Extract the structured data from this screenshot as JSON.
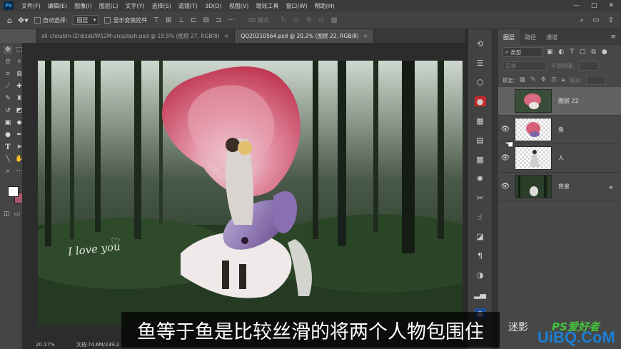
{
  "app": {
    "logo": "Ps",
    "menus": [
      "文件(F)",
      "编辑(E)",
      "图像(I)",
      "图层(L)",
      "文字(Y)",
      "选择(S)",
      "滤镜(T)",
      "3D(D)",
      "视图(V)",
      "增效工具",
      "窗口(W)",
      "帮助(H)"
    ],
    "window_controls": [
      "—",
      "□",
      "✕"
    ]
  },
  "options": {
    "auto_select_label": "自动选择:",
    "auto_select_value": "图层",
    "show_transform_label": "显示变换控件",
    "mode_label": "3D 模式:"
  },
  "tabs": [
    {
      "title": "ali-choubin-lZnbzaUWS2M-unsplash.psd @ 19.5% (图层 27, RGB/8)",
      "active": false
    },
    {
      "title": "QQ20210564.psd @ 20.2% (图层 22, RGB/8)",
      "active": true
    }
  ],
  "tab_close": "×",
  "canvas": {
    "overlay_text": "I love you"
  },
  "status": {
    "zoom": "20.17%",
    "doc_size": "文档:74.6M/239.2"
  },
  "layers_panel": {
    "tabs": [
      "图层",
      "路径",
      "通道"
    ],
    "filter_label": "类型",
    "blend_mode": "正常",
    "opacity_label": "不透明度:",
    "lock_label": "锁定:",
    "fill_label": "填充:",
    "layers": [
      {
        "name": "图层 22",
        "visible": false,
        "selected": true,
        "locked": false
      },
      {
        "name": "鱼",
        "visible": true,
        "selected": false,
        "locked": false
      },
      {
        "name": "人",
        "visible": true,
        "selected": false,
        "locked": false
      },
      {
        "name": "背景",
        "visible": true,
        "selected": false,
        "locked": true
      }
    ]
  },
  "subtitle": "鱼等于鱼是比较丝滑的将两个人物包围住",
  "watermark": {
    "part1": "迷影",
    "part2": "PS爱好者",
    "part3": "UiBQ.CoM"
  },
  "colors": {
    "foreground": "#ffffff",
    "background": "#a85a6c"
  }
}
